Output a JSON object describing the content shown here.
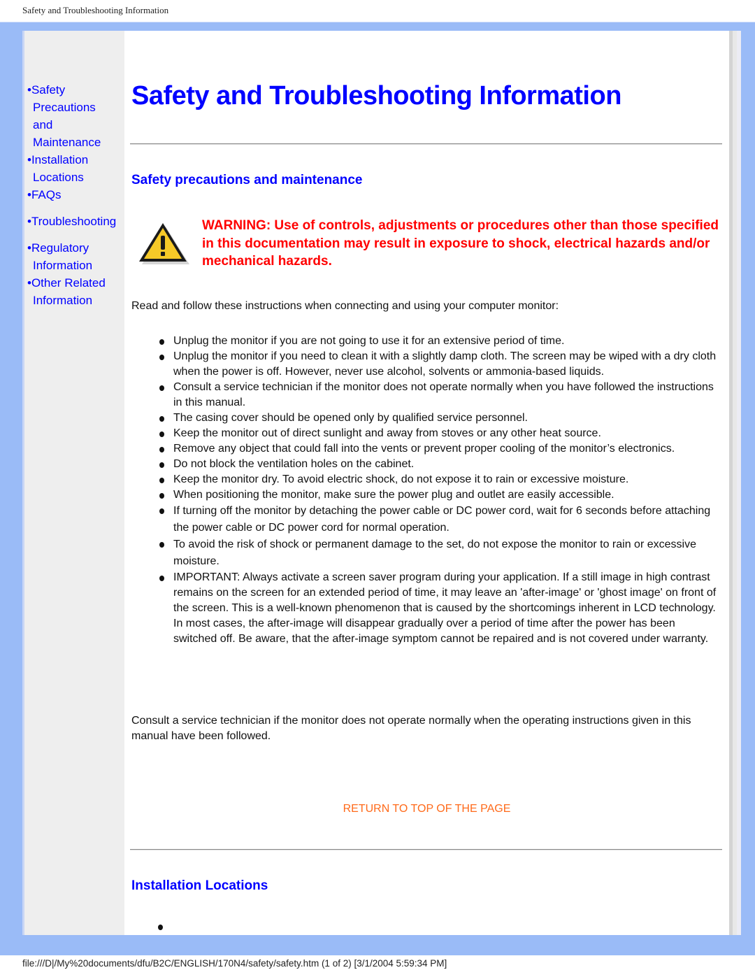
{
  "print_header": "Safety and Troubleshooting Information",
  "sidebar": {
    "items": [
      {
        "lines": [
          "•Safety",
          "Precautions",
          "and",
          "Maintenance"
        ]
      },
      {
        "lines": [
          "•Installation",
          "Locations"
        ]
      },
      {
        "lines": [
          "•FAQs"
        ]
      },
      {
        "lines": [
          "•Troubleshooting"
        ]
      },
      {
        "lines": [
          "•Regulatory",
          "Information"
        ]
      },
      {
        "lines": [
          "•Other Related",
          "Information"
        ]
      }
    ]
  },
  "main": {
    "title": "Safety and Troubleshooting Information",
    "section1": {
      "heading": "Safety precautions and maintenance",
      "warning_icon": "warning-triangle-icon",
      "warning_text": "WARNING: Use of controls, adjustments or procedures other than those specified in this documentation may result in exposure to shock, electrical hazards and/or mechanical hazards.",
      "intro": "Read and follow these instructions when connecting and using your computer monitor:",
      "bullets": [
        "Unplug the monitor if you are not going to use it for an extensive period of time.",
        "Unplug the monitor if you need to clean it with a slightly damp cloth. The screen may be wiped with a dry cloth when the power is off. However, never use alcohol, solvents or ammonia-based liquids.",
        "Consult a service technician if the monitor does not operate normally when you have followed the instructions in this manual.",
        "The casing cover should be opened only by qualified service personnel.",
        "Keep the monitor out of direct sunlight and away from stoves or any other heat source.",
        "Remove any object that could fall into the vents or prevent proper cooling of the monitor’s electronics.",
        "Do not block the ventilation holes on the cabinet.",
        "Keep the monitor dry. To avoid electric shock, do not expose it to rain or excessive moisture.",
        "When positioning the monitor, make sure the power plug and outlet are easily accessible.",
        "If turning off the monitor by detaching the power cable or DC power cord, wait for 6 seconds before attaching the power cable or DC power cord for normal operation.",
        "To avoid the risk of shock or permanent damage to the set, do not expose the monitor to rain or excessive moisture.",
        "IMPORTANT: Always activate a screen saver program during your application. If a still image in high contrast remains on the screen for an extended period of time, it may leave an 'after-image' or 'ghost image' on front of the screen. This is a well-known phenomenon that is caused by the shortcomings inherent in LCD technology. In most cases, the after-image will disappear gradually over a period of time after the power has been switched off. Be aware, that the after-image symptom cannot be repaired and is not covered under warranty."
      ],
      "closing": "Consult a service technician if the monitor does not operate normally when the operating instructions given in this manual have been followed.",
      "return_link": "RETURN TO TOP OF THE PAGE"
    },
    "section2": {
      "heading": "Installation Locations"
    }
  },
  "footer": "file:///D|/My%20documents/dfu/B2C/ENGLISH/170N4/safety/safety.htm (1 of 2) [3/1/2004 5:59:34 PM]",
  "colors": {
    "frame_blue": "#9abbf7",
    "link_blue": "#0000ff",
    "warning_red": "#ff0000",
    "return_orange": "#ff6a1a",
    "sidebar_grey": "#eeeeee"
  }
}
